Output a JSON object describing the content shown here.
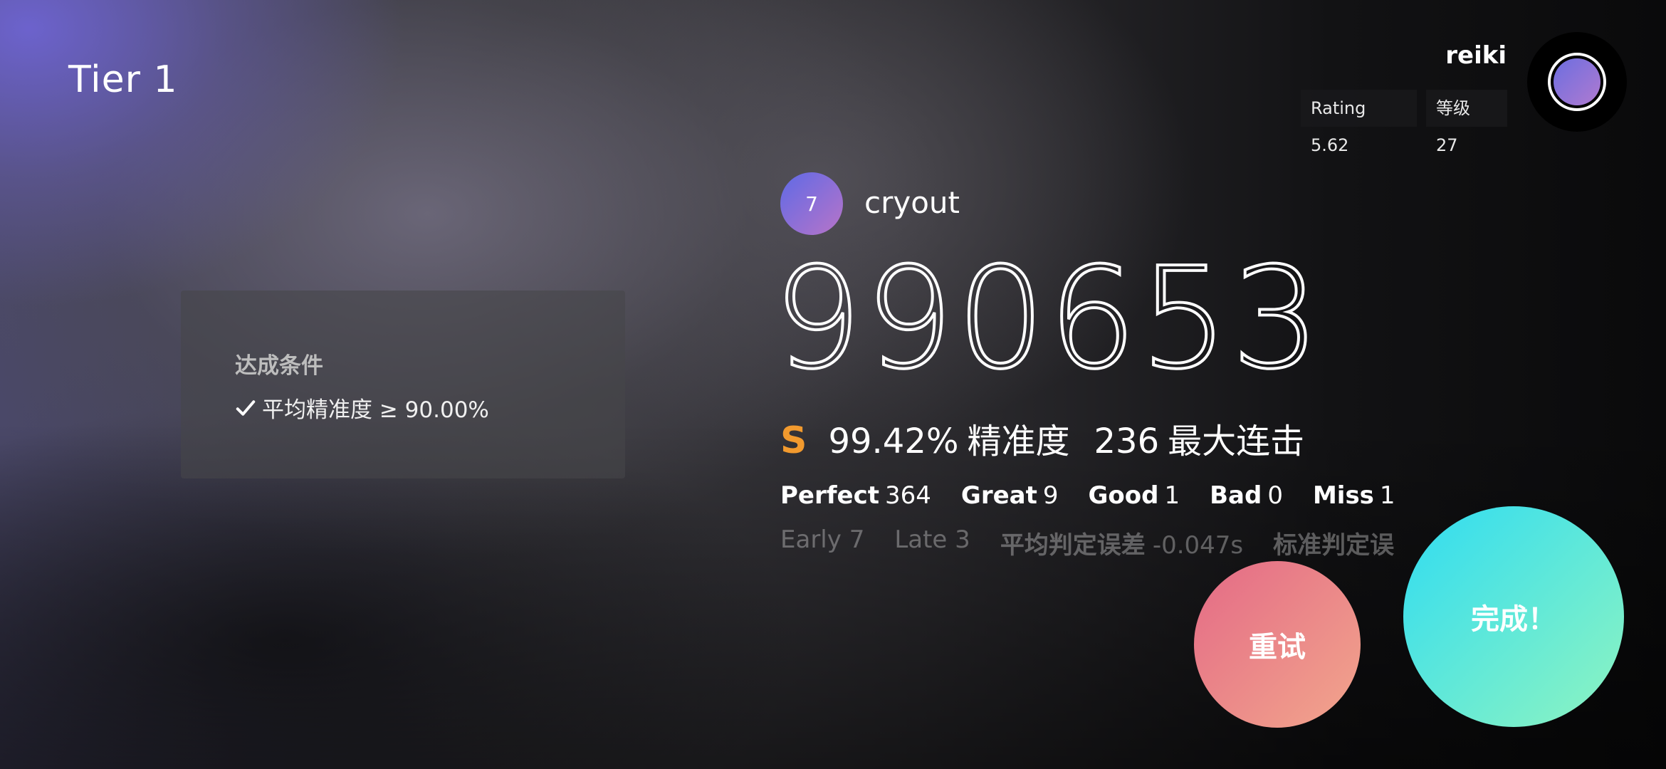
{
  "header": {
    "tier_title": "Tier 1"
  },
  "profile": {
    "username": "reiki",
    "rating": "Rating 5.62",
    "level": "等级 27"
  },
  "criteria": {
    "title": "达成条件",
    "items": [
      {
        "icon": "check-icon",
        "text": "平均精准度 ≥ 90.00%"
      }
    ]
  },
  "song": {
    "level": "7",
    "title": "cryout"
  },
  "result": {
    "score": "990653",
    "grade": "S",
    "grade_color": "#f29a2e",
    "accuracy_value": "99.42%",
    "accuracy_label": "精准度",
    "max_combo_value": "236",
    "max_combo_label": "最大连击"
  },
  "judgements": [
    {
      "label": "Perfect",
      "value": "364"
    },
    {
      "label": "Great",
      "value": "9"
    },
    {
      "label": "Good",
      "value": "1"
    },
    {
      "label": "Bad",
      "value": "0"
    },
    {
      "label": "Miss",
      "value": "1"
    }
  ],
  "timing": [
    {
      "label": "Early",
      "value": "7"
    },
    {
      "label": "Late",
      "value": "3"
    },
    {
      "label": "平均判定误差",
      "value": "-0.047s"
    },
    {
      "label": "标准判定误",
      "value": ""
    }
  ],
  "actions": {
    "retry_label": "重试",
    "done_label": "完成！"
  },
  "colors": {
    "retry_gradient": [
      "#e46a86",
      "#f2a68c"
    ],
    "done_gradient": [
      "#2fdcf2",
      "#8ff4c0"
    ],
    "badge_gradient": [
      "#5f6ae6",
      "#b874c8"
    ]
  }
}
